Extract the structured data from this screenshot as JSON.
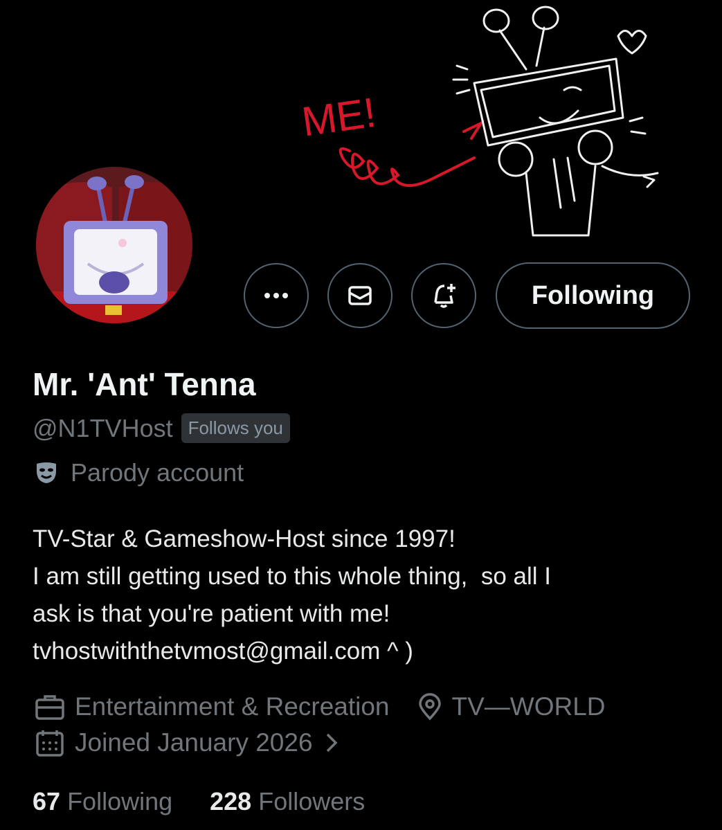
{
  "banner": {
    "doodle_text": "ME!",
    "doodle_color": "#d8182a"
  },
  "profile": {
    "display_name": "Mr. 'Ant' Tenna",
    "handle": "@N1TVHost",
    "follows_you": "Follows you",
    "parody_label": "Parody account",
    "bio_lines": [
      "TV-Star & Gameshow-Host since 1997!",
      "I am still getting used to this whole thing,  so all I",
      "ask is that you're patient with me!",
      "tvhostwiththetvmost@gmail.com ^ )"
    ],
    "category": "Entertainment & Recreation",
    "location": "TV—WORLD",
    "joined": "Joined January 2026"
  },
  "actions": {
    "more_icon": "more-icon",
    "message_icon": "envelope-icon",
    "notify_icon": "bell-plus-icon",
    "following_label": "Following"
  },
  "stats": {
    "following_count": "67",
    "following_label": "Following",
    "followers_count": "228",
    "followers_label": "Followers"
  },
  "colors": {
    "background": "#000000",
    "text_primary": "#e7e9ea",
    "text_secondary": "#71767b",
    "border": "#536471"
  }
}
